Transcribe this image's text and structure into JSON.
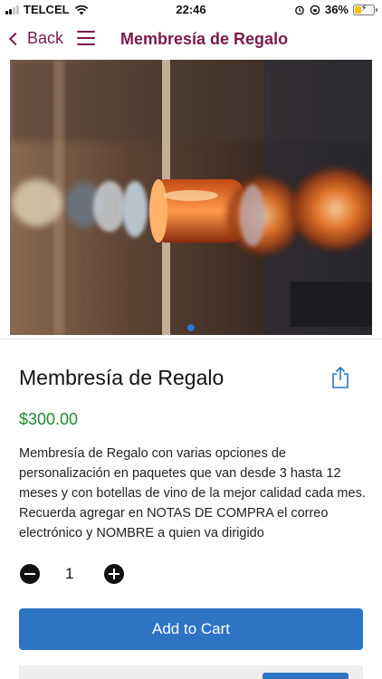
{
  "status_bar": {
    "carrier": "TELCEL",
    "time": "22:46",
    "battery": "36%",
    "battery_level": 0.36
  },
  "nav": {
    "back_label": "Back",
    "title": "Membresía de Regalo"
  },
  "gallery": {
    "image_count": 1,
    "active_index": 0
  },
  "product": {
    "title": "Membresía de Regalo",
    "price": "$300.00",
    "description": "Membresía de Regalo con varias opciones de personalización en paquetes que van desde 3 hasta 12 meses y con botellas de vino de la mejor calidad cada mes. Recuerda agregar en NOTAS DE COMPRA el correo electrónico y NOMBRE a quien va dirigido"
  },
  "quantity": {
    "value": "1"
  },
  "actions": {
    "add_to_cart": "Add to Cart"
  },
  "colors": {
    "accent": "#7a1a4a",
    "price": "#1f8a2c",
    "button": "#2d74c4"
  }
}
